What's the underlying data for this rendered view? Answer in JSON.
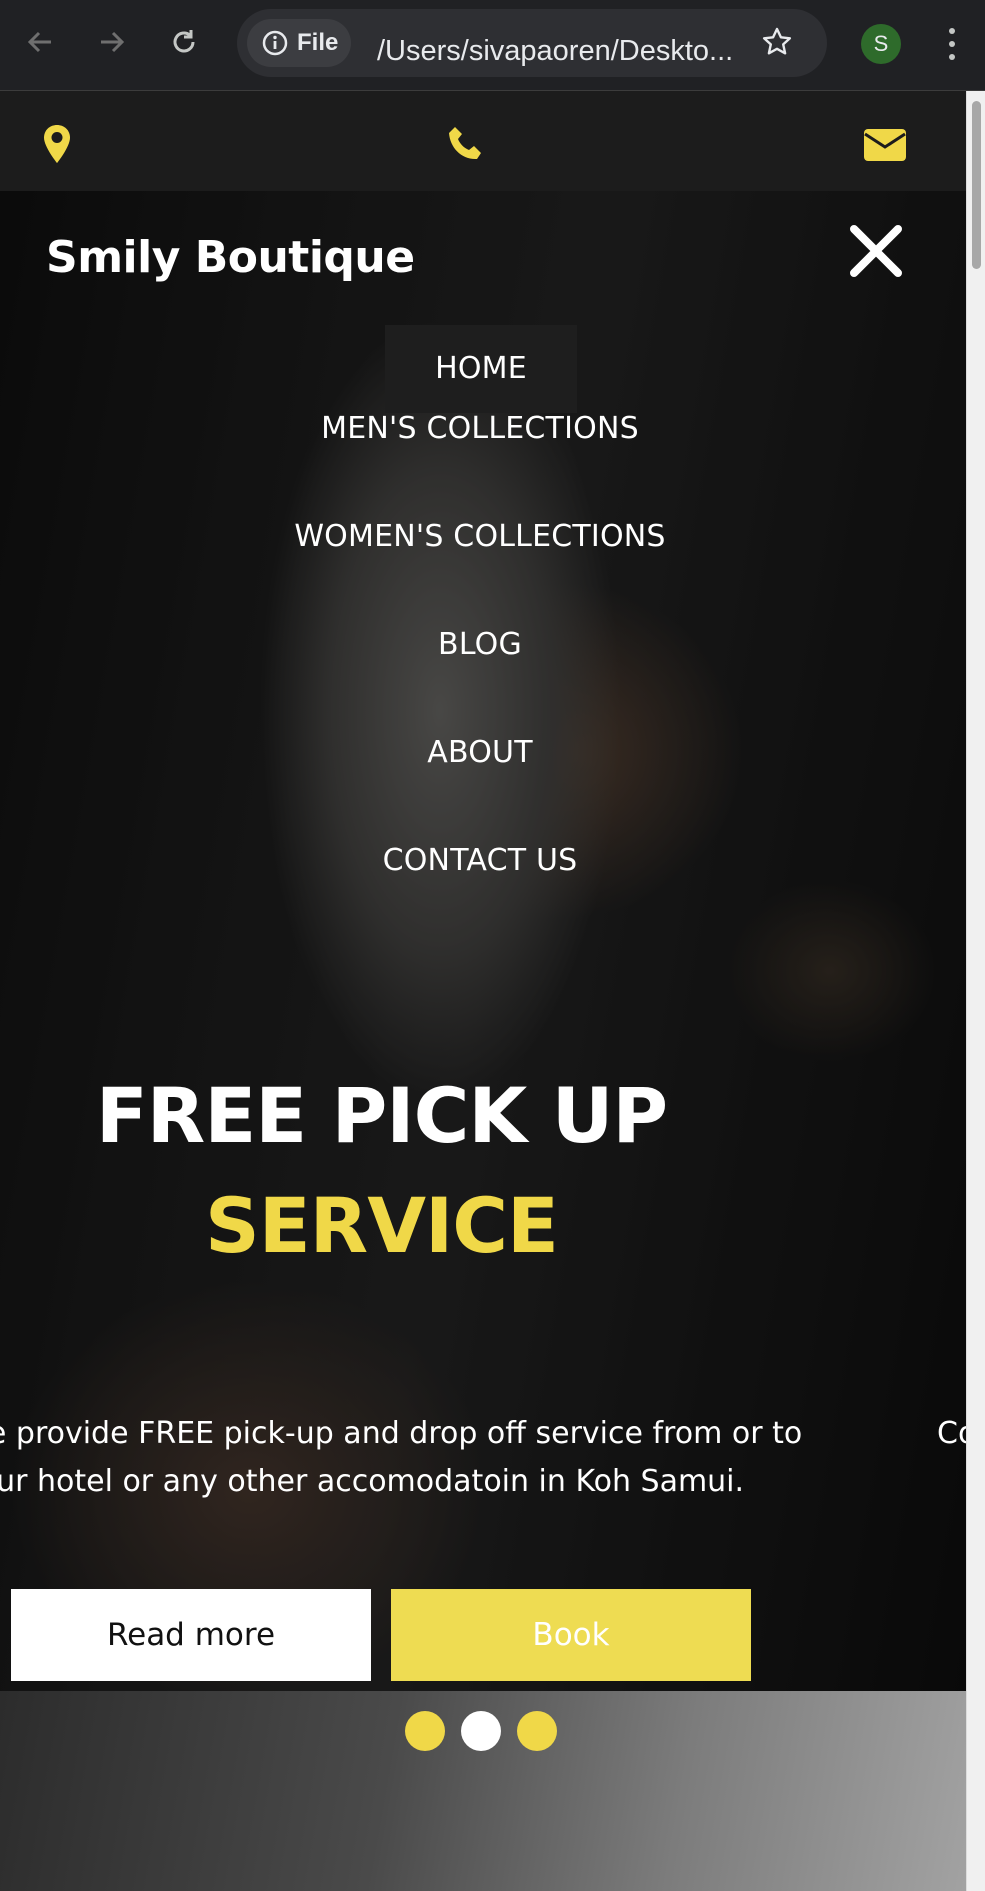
{
  "browser": {
    "file_chip_label": "File",
    "url": "/Users/sivapaoren/Deskto...",
    "profile_initial": "S"
  },
  "topbar": {
    "icons": [
      "map-marker-icon",
      "phone-icon",
      "envelope-icon"
    ],
    "icon_color": "#f0d848"
  },
  "site": {
    "brand": "Smily Boutique"
  },
  "menu": {
    "items": [
      {
        "label": "HOME",
        "active": true
      },
      {
        "label": "MEN'S COLLECTIONS",
        "active": false
      },
      {
        "label": "WOMEN'S COLLECTIONS",
        "active": false
      },
      {
        "label": "BLOG",
        "active": false
      },
      {
        "label": "ABOUT",
        "active": false
      },
      {
        "label": "CONTACT US",
        "active": false
      }
    ]
  },
  "slide": {
    "headline_line1": "FREE PICK UP",
    "headline_line2": "SERVICE",
    "description_line1": "We provide FREE pick-up and drop off service from or to",
    "description_line2": "your hotel or any other accomodatoin in Koh Samui.",
    "next_slide_peek": "Co",
    "read_more_label": "Read more",
    "book_label": "Book"
  },
  "carousel": {
    "dots": 3,
    "active_index": 1,
    "accent_color": "#f0d848"
  }
}
